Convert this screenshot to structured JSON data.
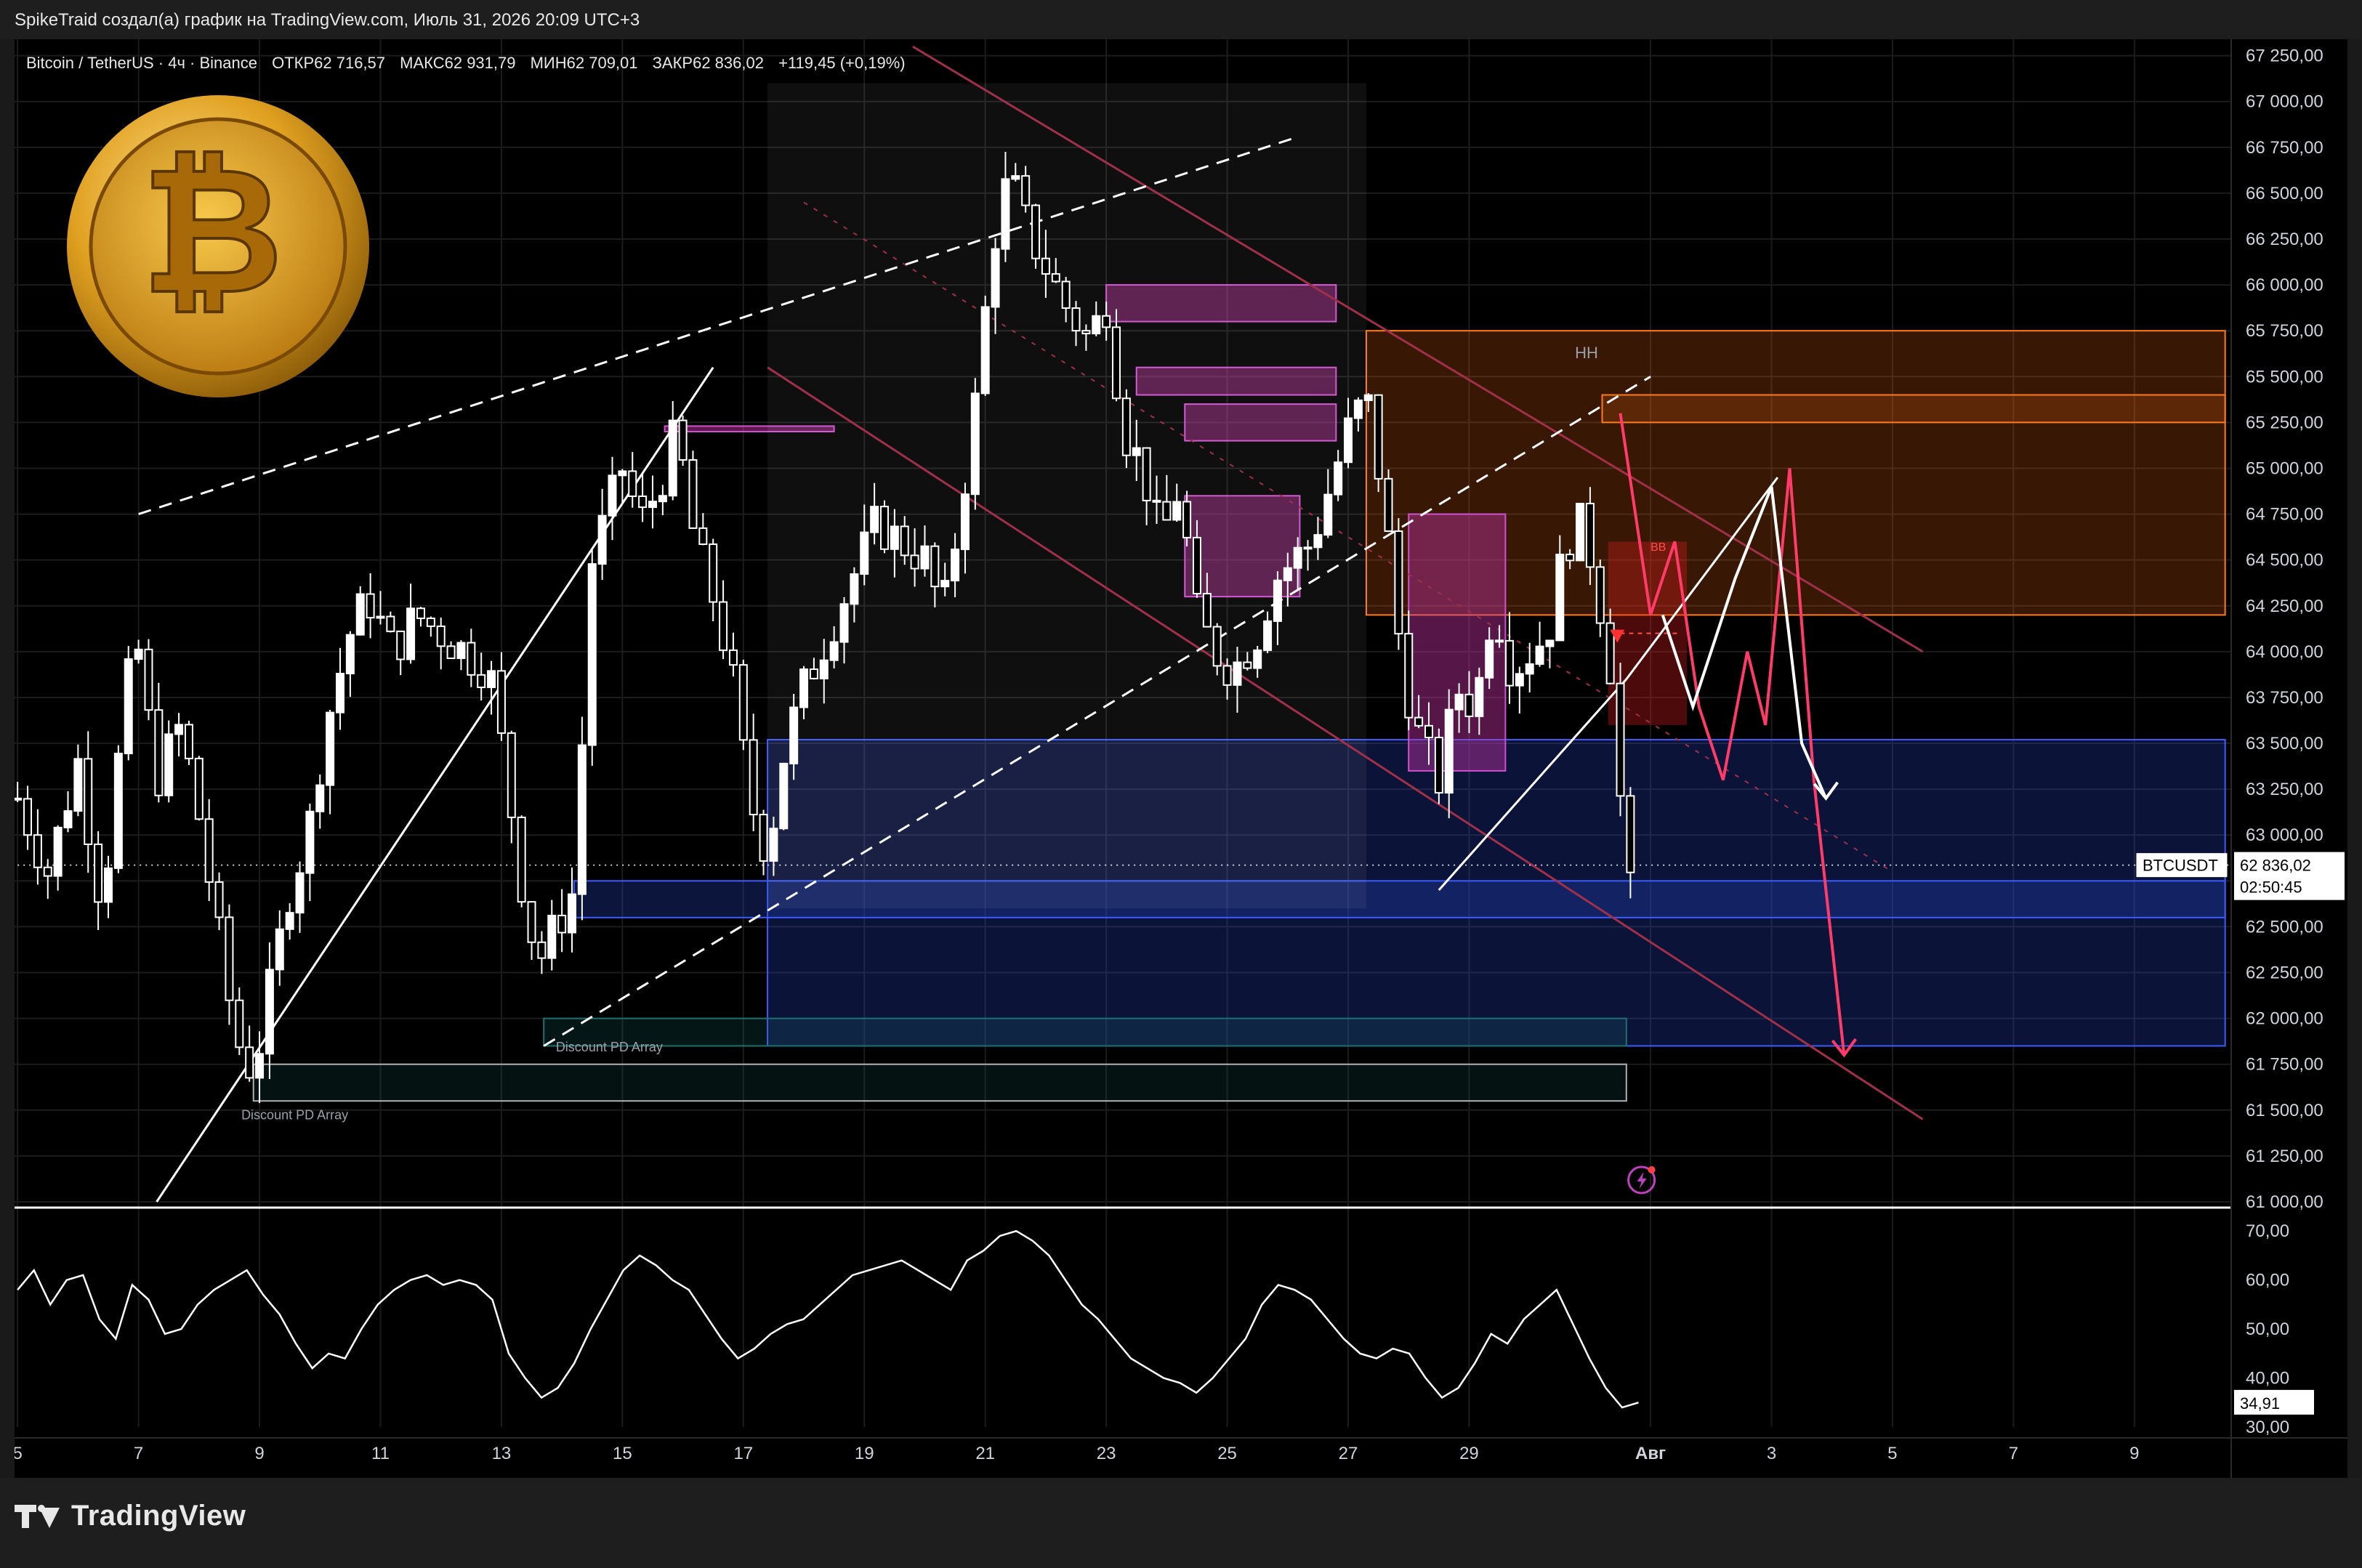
{
  "header": {
    "title": "SpikeTraid создал(а) график на TradingView.com, Июль 31, 2026 20:09 UTC+3"
  },
  "legend": {
    "symbol": "Bitcoin / TetherUS · 4ч · Binance",
    "open": "ОТКР62 716,57",
    "high": "МАКС62 931,79",
    "low": "МИН62 709,01",
    "close": "ЗАКР62 836,02",
    "change": "+119,45 (+0,19%)"
  },
  "price_tag": {
    "symbol": "BTCUSDT",
    "price": "62 836,02",
    "countdown": "02:50:45"
  },
  "rsi_tag": {
    "value": "34,91"
  },
  "annotations": {
    "hh": "HH",
    "bb": "BB",
    "discount1": "Discount PD Array",
    "discount2": "Discount PD Array"
  },
  "footer": {
    "brand": "TradingView"
  },
  "colors": {
    "up": "#ffffff",
    "down": "#ffffff",
    "orange_zone": "#ff7a1a",
    "blue_zone": "#2e4bd1",
    "magenta_zone": "#c040c0",
    "channel": "#a0304a",
    "arrow_red": "#ff3b6a",
    "arrow_white": "#ffffff"
  },
  "chart_data": [
    {
      "type": "candlestick",
      "timeframe": "4h",
      "y_axis_labels": [
        "67 250,00",
        "67 000,00",
        "66 750,00",
        "66 500,00",
        "66 250,00",
        "66 000,00",
        "65 750,00",
        "65 500,00",
        "65 250,00",
        "65 000,00",
        "64 750,00",
        "64 500,00",
        "64 250,00",
        "64 000,00",
        "63 750,00",
        "63 500,00",
        "63 250,00",
        "63 000,00",
        "62 750,00",
        "62 500,00",
        "62 250,00",
        "62 000,00",
        "61 750,00",
        "61 500,00",
        "61 250,00",
        "61 000,00"
      ],
      "ylim": [
        61000,
        67300
      ],
      "x_axis_labels": [
        "5",
        "7",
        "9",
        "11",
        "13",
        "15",
        "17",
        "19",
        "21",
        "23",
        "25",
        "27",
        "29",
        "Авг",
        "3",
        "5",
        "7",
        "9"
      ],
      "x_days": [
        5,
        7,
        9,
        11,
        13,
        15,
        17,
        19,
        21,
        23,
        25,
        27,
        29,
        32,
        34,
        36,
        38,
        40
      ],
      "close_path": [
        {
          "day": 5.0,
          "p": 63200
        },
        {
          "day": 5.5,
          "p": 62800
        },
        {
          "day": 6.0,
          "p": 63400
        },
        {
          "day": 6.4,
          "p": 62600
        },
        {
          "day": 6.8,
          "p": 63800
        },
        {
          "day": 7.0,
          "p": 64000
        },
        {
          "day": 7.3,
          "p": 63300
        },
        {
          "day": 7.7,
          "p": 63600
        },
        {
          "day": 8.0,
          "p": 63100
        },
        {
          "day": 8.3,
          "p": 62500
        },
        {
          "day": 8.6,
          "p": 61900
        },
        {
          "day": 8.9,
          "p": 61700
        },
        {
          "day": 9.2,
          "p": 62200
        },
        {
          "day": 9.5,
          "p": 62700
        },
        {
          "day": 9.8,
          "p": 63000
        },
        {
          "day": 10.1,
          "p": 63600
        },
        {
          "day": 10.5,
          "p": 64100
        },
        {
          "day": 10.8,
          "p": 64300
        },
        {
          "day": 11.2,
          "p": 64000
        },
        {
          "day": 11.6,
          "p": 64200
        },
        {
          "day": 12.0,
          "p": 64100
        },
        {
          "day": 12.4,
          "p": 64000
        },
        {
          "day": 12.8,
          "p": 63900
        },
        {
          "day": 13.1,
          "p": 63300
        },
        {
          "day": 13.3,
          "p": 62800
        },
        {
          "day": 13.6,
          "p": 62300
        },
        {
          "day": 13.9,
          "p": 62500
        },
        {
          "day": 14.2,
          "p": 62700
        },
        {
          "day": 14.5,
          "p": 64500
        },
        {
          "day": 14.8,
          "p": 64800
        },
        {
          "day": 15.0,
          "p": 65000
        },
        {
          "day": 15.3,
          "p": 64700
        },
        {
          "day": 15.6,
          "p": 64900
        },
        {
          "day": 15.9,
          "p": 65200
        },
        {
          "day": 16.2,
          "p": 64600
        },
        {
          "day": 16.5,
          "p": 64300
        },
        {
          "day": 16.8,
          "p": 63900
        },
        {
          "day": 17.1,
          "p": 63200
        },
        {
          "day": 17.4,
          "p": 62900
        },
        {
          "day": 17.7,
          "p": 63500
        },
        {
          "day": 18.0,
          "p": 63800
        },
        {
          "day": 18.4,
          "p": 64100
        },
        {
          "day": 18.8,
          "p": 64400
        },
        {
          "day": 19.2,
          "p": 64700
        },
        {
          "day": 19.6,
          "p": 64600
        },
        {
          "day": 20.0,
          "p": 64500
        },
        {
          "day": 20.3,
          "p": 64200
        },
        {
          "day": 20.6,
          "p": 64800
        },
        {
          "day": 20.9,
          "p": 65500
        },
        {
          "day": 21.1,
          "p": 66200
        },
        {
          "day": 21.4,
          "p": 66600
        },
        {
          "day": 21.7,
          "p": 66300
        },
        {
          "day": 22.0,
          "p": 66100
        },
        {
          "day": 22.3,
          "p": 65900
        },
        {
          "day": 22.7,
          "p": 65700
        },
        {
          "day": 23.0,
          "p": 65900
        },
        {
          "day": 23.3,
          "p": 65200
        },
        {
          "day": 23.6,
          "p": 65000
        },
        {
          "day": 23.9,
          "p": 64600
        },
        {
          "day": 24.2,
          "p": 64900
        },
        {
          "day": 24.5,
          "p": 64200
        },
        {
          "day": 24.8,
          "p": 64000
        },
        {
          "day": 25.1,
          "p": 63900
        },
        {
          "day": 25.5,
          "p": 64100
        },
        {
          "day": 25.8,
          "p": 64400
        },
        {
          "day": 26.1,
          "p": 64500
        },
        {
          "day": 26.4,
          "p": 64600
        },
        {
          "day": 26.7,
          "p": 64900
        },
        {
          "day": 27.0,
          "p": 65200
        },
        {
          "day": 27.3,
          "p": 65400
        },
        {
          "day": 27.6,
          "p": 64800
        },
        {
          "day": 27.9,
          "p": 63900
        },
        {
          "day": 28.2,
          "p": 63500
        },
        {
          "day": 28.5,
          "p": 63300
        },
        {
          "day": 28.8,
          "p": 63800
        },
        {
          "day": 29.1,
          "p": 63700
        },
        {
          "day": 29.4,
          "p": 64300
        },
        {
          "day": 29.7,
          "p": 63900
        },
        {
          "day": 30.0,
          "p": 64000
        },
        {
          "day": 30.3,
          "p": 64100
        },
        {
          "day": 30.6,
          "p": 64600
        },
        {
          "day": 30.9,
          "p": 64700
        },
        {
          "day": 31.2,
          "p": 64200
        },
        {
          "day": 31.4,
          "p": 63800
        },
        {
          "day": 31.6,
          "p": 62600
        },
        {
          "day": 31.8,
          "p": 62836
        }
      ],
      "zones": [
        {
          "kind": "orange",
          "y1": 65750,
          "y2": 64200,
          "x1": 27.3,
          "x2": 41.5
        },
        {
          "kind": "orange-dark",
          "y1": 65400,
          "y2": 65250,
          "x1": 31.2,
          "x2": 41.5
        },
        {
          "kind": "blue",
          "y1": 63520,
          "y2": 61850,
          "x1": 17.4,
          "x2": 41.5
        },
        {
          "kind": "blue-line",
          "y1": 62750,
          "y2": 62550,
          "x1": 14.2,
          "x2": 41.5
        },
        {
          "kind": "teal",
          "y1": 62000,
          "y2": 61850,
          "x1": 13.7,
          "x2": 31.6
        },
        {
          "kind": "teal-dark",
          "y1": 61750,
          "y2": 61550,
          "x1": 8.9,
          "x2": 31.6
        },
        {
          "kind": "magenta",
          "y1": 66000,
          "y2": 65800,
          "x1": 23.0,
          "x2": 26.8
        },
        {
          "kind": "magenta",
          "y1": 65550,
          "y2": 65400,
          "x1": 23.5,
          "x2": 26.8
        },
        {
          "kind": "magenta",
          "y1": 65350,
          "y2": 65150,
          "x1": 24.3,
          "x2": 26.8
        },
        {
          "kind": "magenta",
          "y1": 64850,
          "y2": 64300,
          "x1": 24.3,
          "x2": 26.2
        },
        {
          "kind": "magenta",
          "y1": 64750,
          "y2": 63350,
          "x1": 28.0,
          "x2": 29.6
        },
        {
          "kind": "magenta-thin",
          "y1": 65230,
          "y2": 65200,
          "x1": 15.7,
          "x2": 18.5
        },
        {
          "kind": "red-bb",
          "y1": 64600,
          "y2": 63600,
          "x1": 31.3,
          "x2": 32.6
        },
        {
          "kind": "grey-shade",
          "y1": 67100,
          "y2": 62600,
          "x1": 17.4,
          "x2": 27.3
        }
      ],
      "rsi": {
        "y_axis_labels": [
          "70,00",
          "60,00",
          "50,00",
          "40,00",
          "30,00"
        ],
        "ylim": [
          30,
          73
        ],
        "values": [
          58,
          62,
          55,
          60,
          61,
          52,
          48,
          59,
          56,
          49,
          50,
          55,
          58,
          60,
          62,
          57,
          53,
          47,
          42,
          45,
          44,
          50,
          55,
          58,
          60,
          61,
          59,
          60,
          59,
          56,
          45,
          40,
          36,
          38,
          43,
          50,
          56,
          62,
          65,
          63,
          60,
          58,
          53,
          48,
          44,
          46,
          49,
          51,
          52,
          55,
          58,
          61,
          62,
          63,
          64,
          62,
          60,
          58,
          64,
          66,
          69,
          70,
          68,
          65,
          60,
          55,
          52,
          48,
          44,
          42,
          40,
          39,
          37,
          40,
          44,
          48,
          55,
          59,
          58,
          56,
          52,
          48,
          45,
          44,
          46,
          45,
          40,
          36,
          38,
          43,
          49,
          47,
          52,
          55,
          58,
          51,
          44,
          38,
          34,
          35
        ]
      },
      "arrows": [
        {
          "color": "red",
          "points": [
            [
              31.5,
              65300
            ],
            [
              32.0,
              64200
            ],
            [
              32.4,
              64600
            ],
            [
              32.8,
              63700
            ],
            [
              33.2,
              63300
            ],
            [
              33.6,
              64000
            ],
            [
              33.9,
              63600
            ],
            [
              34.3,
              65000
            ],
            [
              34.7,
              63300
            ],
            [
              35.2,
              61800
            ]
          ]
        },
        {
          "color": "white",
          "points": [
            [
              32.2,
              64200
            ],
            [
              32.7,
              63700
            ],
            [
              33.4,
              64400
            ],
            [
              34.0,
              64900
            ],
            [
              34.5,
              63500
            ],
            [
              34.9,
              63200
            ]
          ]
        }
      ]
    }
  ]
}
